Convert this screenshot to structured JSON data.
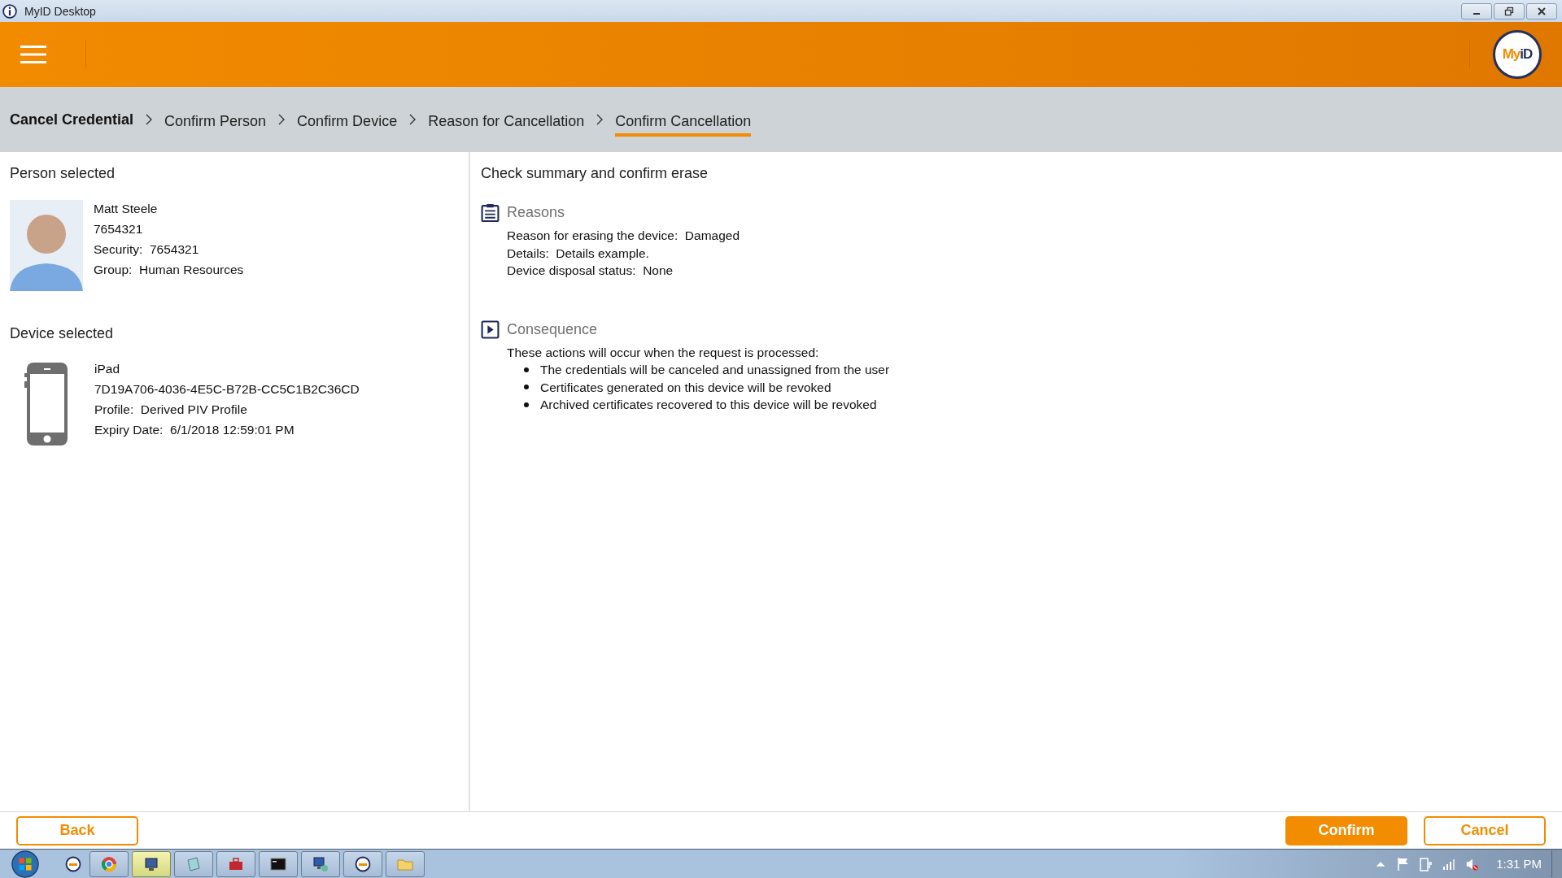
{
  "window": {
    "title": "MyID Desktop"
  },
  "header": {
    "logo": [
      "My",
      "iD"
    ]
  },
  "breadcrumb": {
    "title": "Cancel Credential",
    "steps": [
      {
        "label": "Confirm Person",
        "selected": false
      },
      {
        "label": "Confirm Device",
        "selected": false
      },
      {
        "label": "Reason for Cancellation",
        "selected": false
      },
      {
        "label": "Confirm Cancellation",
        "selected": true
      }
    ]
  },
  "person": {
    "heading": "Person selected",
    "lines": [
      {
        "text": "Matt Steele"
      },
      {
        "text": "7654321"
      },
      {
        "label": "Security:",
        "text": "7654321"
      },
      {
        "label": "Group:",
        "text": "Human Resources"
      }
    ]
  },
  "device": {
    "heading": "Device selected",
    "lines": [
      {
        "text": "iPad"
      },
      {
        "text": "7D19A706-4036-4E5C-B72B-CC5C1B2C36CD"
      },
      {
        "label": "Profile:",
        "text": "Derived PIV Profile"
      },
      {
        "label": "Expiry Date:",
        "text": "6/1/2018 12:59:01 PM"
      }
    ]
  },
  "summary": {
    "heading": "Check summary and confirm erase",
    "sections": [
      {
        "kind": "reasons",
        "title": "Reasons",
        "lines": [
          {
            "label": "Reason for erasing the device:",
            "text": "Damaged"
          },
          {
            "label": "Details:",
            "text": "Details example."
          },
          {
            "label": "Device disposal status:",
            "text": "None"
          }
        ]
      },
      {
        "kind": "consequence",
        "title": "Consequence",
        "intro": "These actions will occur when the request is processed:",
        "bullets": [
          "The credentials will be canceled and unassigned from the user",
          "Certificates generated on this device will be revoked",
          "Archived certificates recovered to this device will be revoked"
        ]
      }
    ]
  },
  "buttons": [
    {
      "label": "Back",
      "kind": "secondary"
    },
    {
      "label": "Confirm",
      "kind": "primary"
    },
    {
      "label": "Cancel",
      "kind": "secondary"
    }
  ],
  "taskbar": {
    "apps": [
      {
        "kind": "myid",
        "selected": false
      },
      {
        "kind": "browser",
        "selected": false
      },
      {
        "kind": "tool",
        "selected": true
      },
      {
        "kind": "notepad",
        "selected": false
      },
      {
        "kind": "toolbox",
        "selected": false
      },
      {
        "kind": "console",
        "selected": false
      },
      {
        "kind": "remote",
        "selected": false
      },
      {
        "kind": "myid",
        "selected": false
      },
      {
        "kind": "folder",
        "selected": false
      }
    ],
    "clock": "1:31 PM"
  }
}
